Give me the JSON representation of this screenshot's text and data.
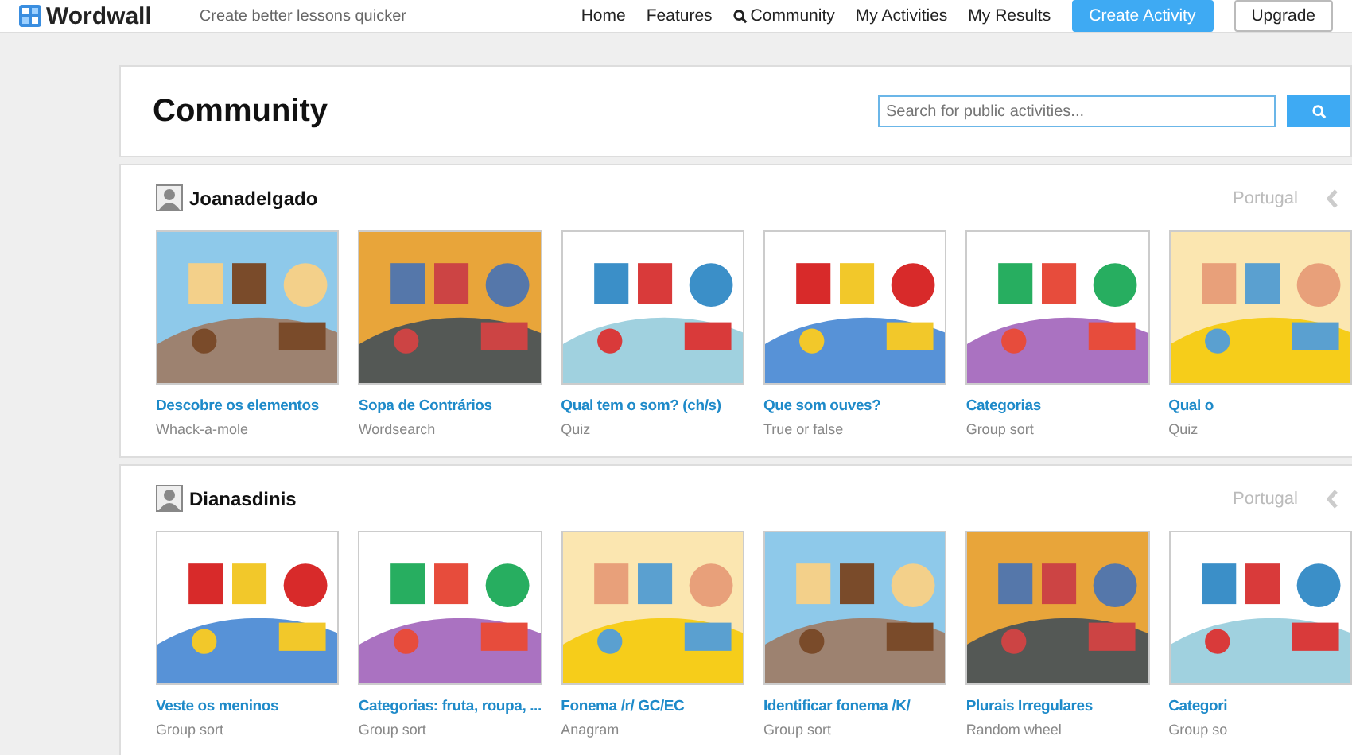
{
  "header": {
    "logo": "Wordwall",
    "tagline": "Create better lessons quicker",
    "nav": [
      {
        "label": "Home",
        "kind": "link"
      },
      {
        "label": "Features",
        "kind": "link"
      },
      {
        "label": "Community",
        "kind": "search"
      },
      {
        "label": "My Activities",
        "kind": "link"
      },
      {
        "label": "My Results",
        "kind": "link"
      }
    ],
    "create_button": "Create Activity",
    "upgrade_button": "Upgrade"
  },
  "page_title": "Community",
  "search": {
    "placeholder": "Search for public activities..."
  },
  "sections": [
    {
      "user": "Joanadelgado",
      "country": "Portugal",
      "activities": [
        {
          "title": "Descobre os elementos",
          "type": "Whack-a-mole"
        },
        {
          "title": "Sopa de Contrários",
          "type": "Wordsearch"
        },
        {
          "title": "Qual tem o som? (ch/s)",
          "type": "Quiz"
        },
        {
          "title": "Que som ouves?",
          "type": "True or false"
        },
        {
          "title": "Categorias",
          "type": "Group sort"
        },
        {
          "title": "Qual o",
          "type": "Quiz"
        }
      ]
    },
    {
      "user": "Dianasdinis",
      "country": "Portugal",
      "activities": [
        {
          "title": "Veste os meninos",
          "type": "Group sort"
        },
        {
          "title": "Categorias: fruta, roupa, ...",
          "type": "Group sort"
        },
        {
          "title": "Fonema /r/ GC/EC",
          "type": "Anagram"
        },
        {
          "title": "Identificar fonema /K/",
          "type": "Group sort"
        },
        {
          "title": "Plurais Irregulares",
          "type": "Random wheel"
        },
        {
          "title": "Categori",
          "type": "Group so"
        }
      ]
    }
  ]
}
